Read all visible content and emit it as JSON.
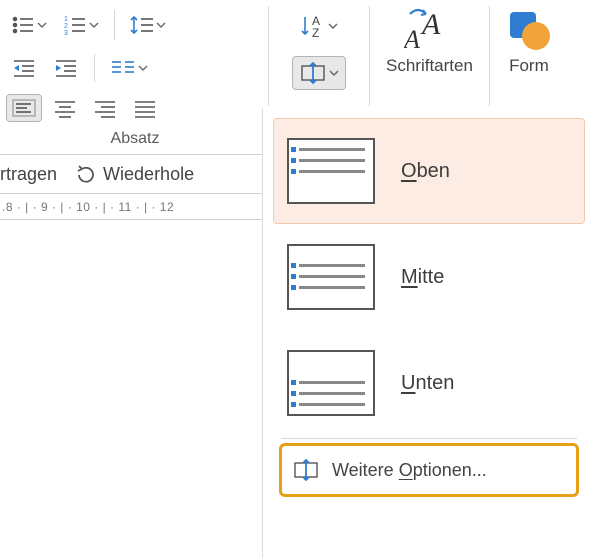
{
  "ribbon": {
    "group_label": "Absatz",
    "fonts_label": "Schriftarten",
    "shapes_label": "Form"
  },
  "qat": {
    "undo_suffix": "rtragen",
    "redo_label": "Wiederhole"
  },
  "ruler": ".8 · | · 9 · | · 10 · | · 11 · | · 12",
  "dropdown": {
    "top": "Oben",
    "top_u": "O",
    "middle": "Mitte",
    "middle_u": "M",
    "bottom": "Unten",
    "bottom_u": "U",
    "more": "Weitere Optionen...",
    "more_u": "O"
  }
}
